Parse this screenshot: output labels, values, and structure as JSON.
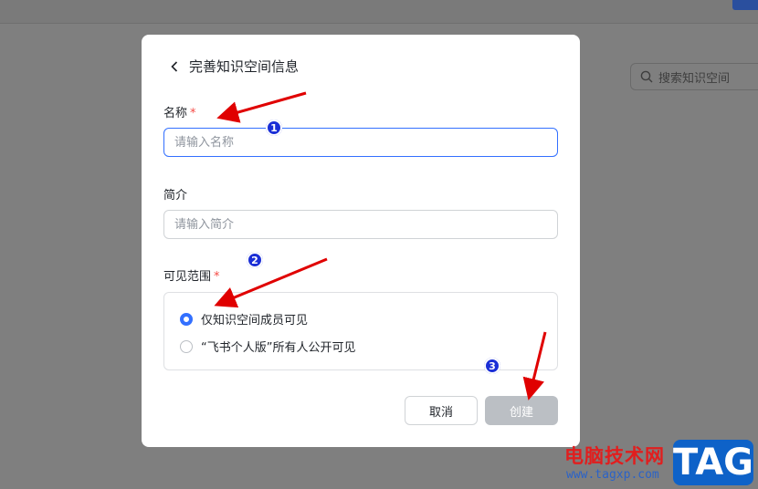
{
  "background": {
    "search_placeholder": "搜索知识空间"
  },
  "dialog": {
    "title": "完善知识空间信息",
    "name_label": "名称",
    "name_placeholder": "请输入名称",
    "intro_label": "简介",
    "intro_placeholder": "请输入简介",
    "visibility_label": "可见范围",
    "required_mark": "*",
    "visibility_options": [
      {
        "label": "仅知识空间成员可见",
        "checked": true
      },
      {
        "label": "“飞书个人版”所有人公开可见",
        "checked": false
      }
    ],
    "cancel_label": "取消",
    "create_label": "创建"
  },
  "annotations": {
    "markers": [
      "1",
      "2",
      "3"
    ],
    "arrow_color": "#e00000",
    "marker_color": "#1b2fd6"
  },
  "watermark": {
    "site_name": "电脑技术网",
    "url": "www.tagxp.com",
    "tag": "TAG"
  },
  "colors": {
    "accent": "#3370ff",
    "disabled_button": "#bbbfc4",
    "required": "#f54a45"
  }
}
